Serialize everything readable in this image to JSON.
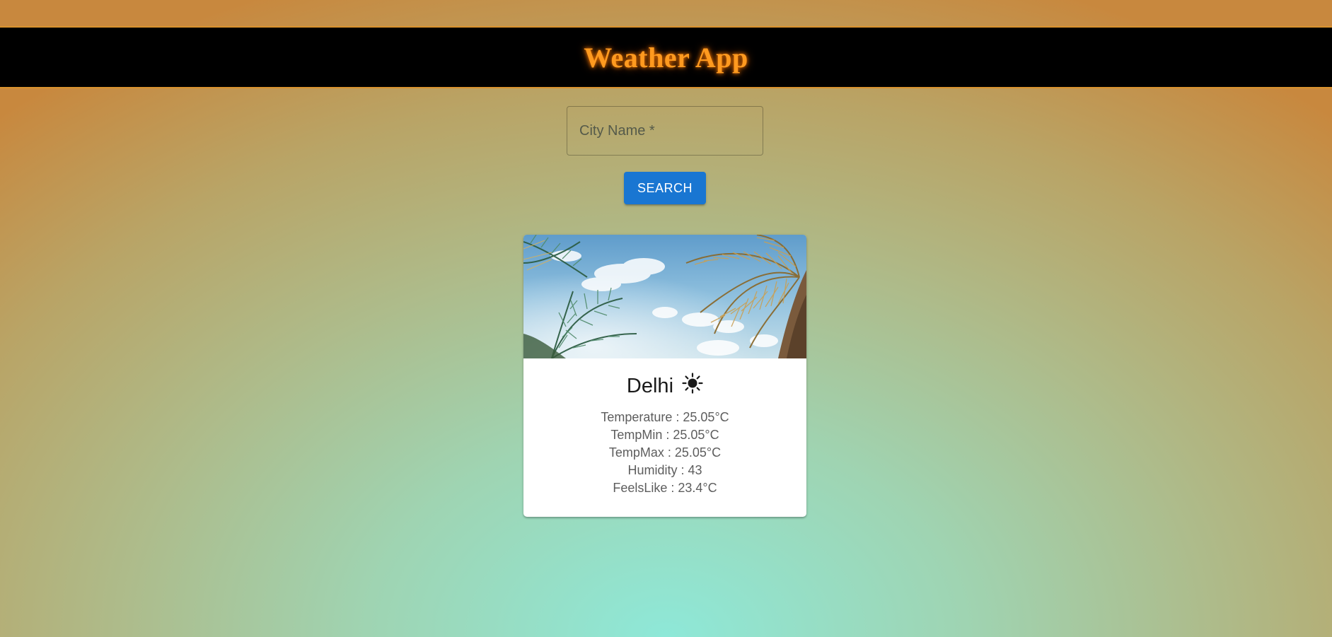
{
  "app": {
    "title": "Weather App"
  },
  "search": {
    "placeholder": "City Name *",
    "value": "",
    "button_label": "SEARCH"
  },
  "card": {
    "city": "Delhi",
    "weather_icon": "sun-icon",
    "details": [
      "Temperature : 25.05°C",
      "TempMin : 25.05°C",
      "TempMax : 25.05°C",
      "Humidity : 43",
      "FeelsLike : 23.4°C"
    ],
    "image": "palm-trees-sky-photo"
  },
  "colors": {
    "header_bg": "#000000",
    "title": "#ff9a1f",
    "button": "#1976d2",
    "header_border": "#d9922e"
  }
}
